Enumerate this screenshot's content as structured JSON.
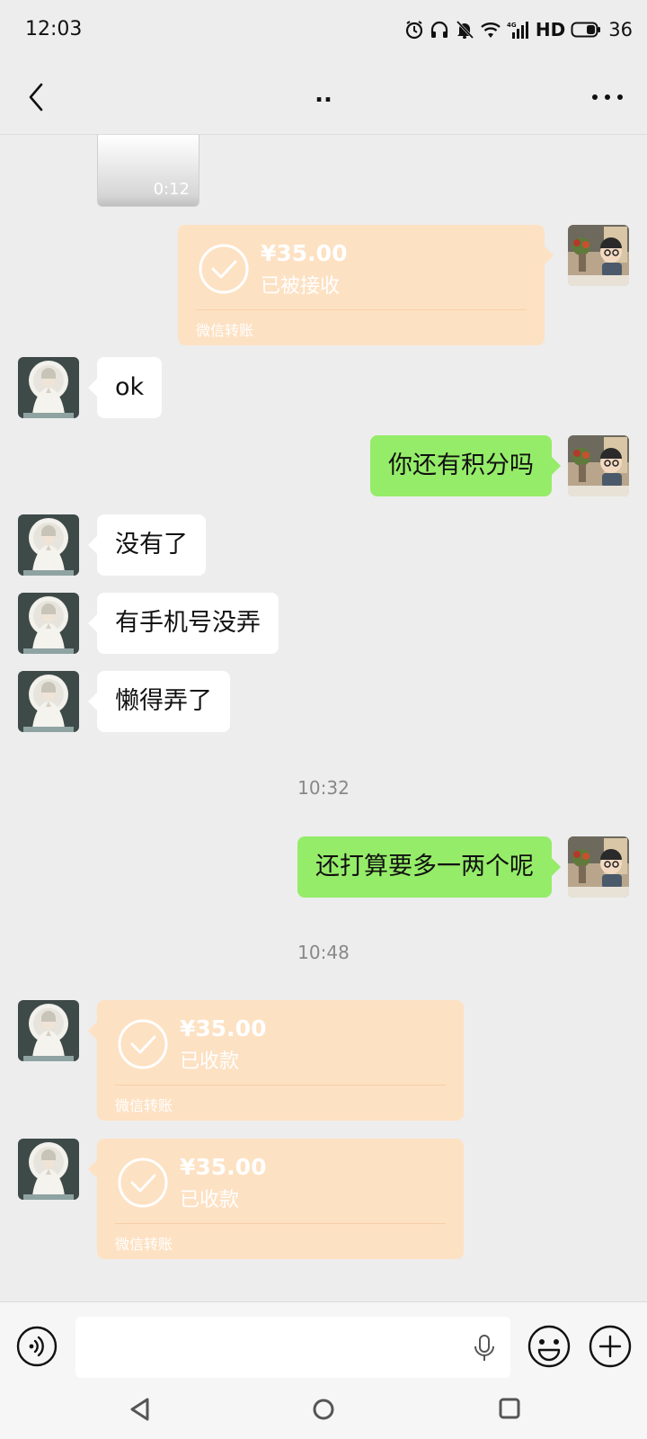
{
  "status_bar": {
    "time": "12:03",
    "network_label": "HD",
    "network_gen": "4G",
    "battery_level": "36",
    "icons": [
      "alarm-icon",
      "headphones-icon",
      "mute-bell-icon",
      "wifi-icon",
      "signal-icon",
      "battery-icon"
    ]
  },
  "header": {
    "title": "..",
    "back_icon": "chevron-left-icon",
    "more_icon": "more-dots-icon"
  },
  "colors": {
    "background": "#ededed",
    "outgoing_bubble": "#95ec69",
    "incoming_bubble": "#ffffff",
    "transfer_card": "#fde1c3",
    "timestamp_text": "#888888"
  },
  "messages": {
    "video": {
      "duration": "0:12"
    },
    "transfer1": {
      "amount": "¥35.00",
      "status": "已被接收",
      "footer": "微信转账"
    },
    "msg_ok": "ok",
    "msg_points": "你还有积分吗",
    "msg_none": "没有了",
    "msg_phone": "有手机号没弄",
    "msg_lazy": "懒得弄了",
    "time1": "10:32",
    "msg_plan": "还打算要多一两个呢",
    "time2": "10:48",
    "transfer2": {
      "amount": "¥35.00",
      "status": "已收款",
      "footer": "微信转账"
    },
    "transfer3": {
      "amount": "¥35.00",
      "status": "已收款",
      "footer": "微信转账"
    }
  },
  "input_bar": {
    "voice_icon": "voice-mode-icon",
    "mic_icon": "microphone-icon",
    "emoji_icon": "emoji-icon",
    "plus_icon": "plus-icon"
  }
}
